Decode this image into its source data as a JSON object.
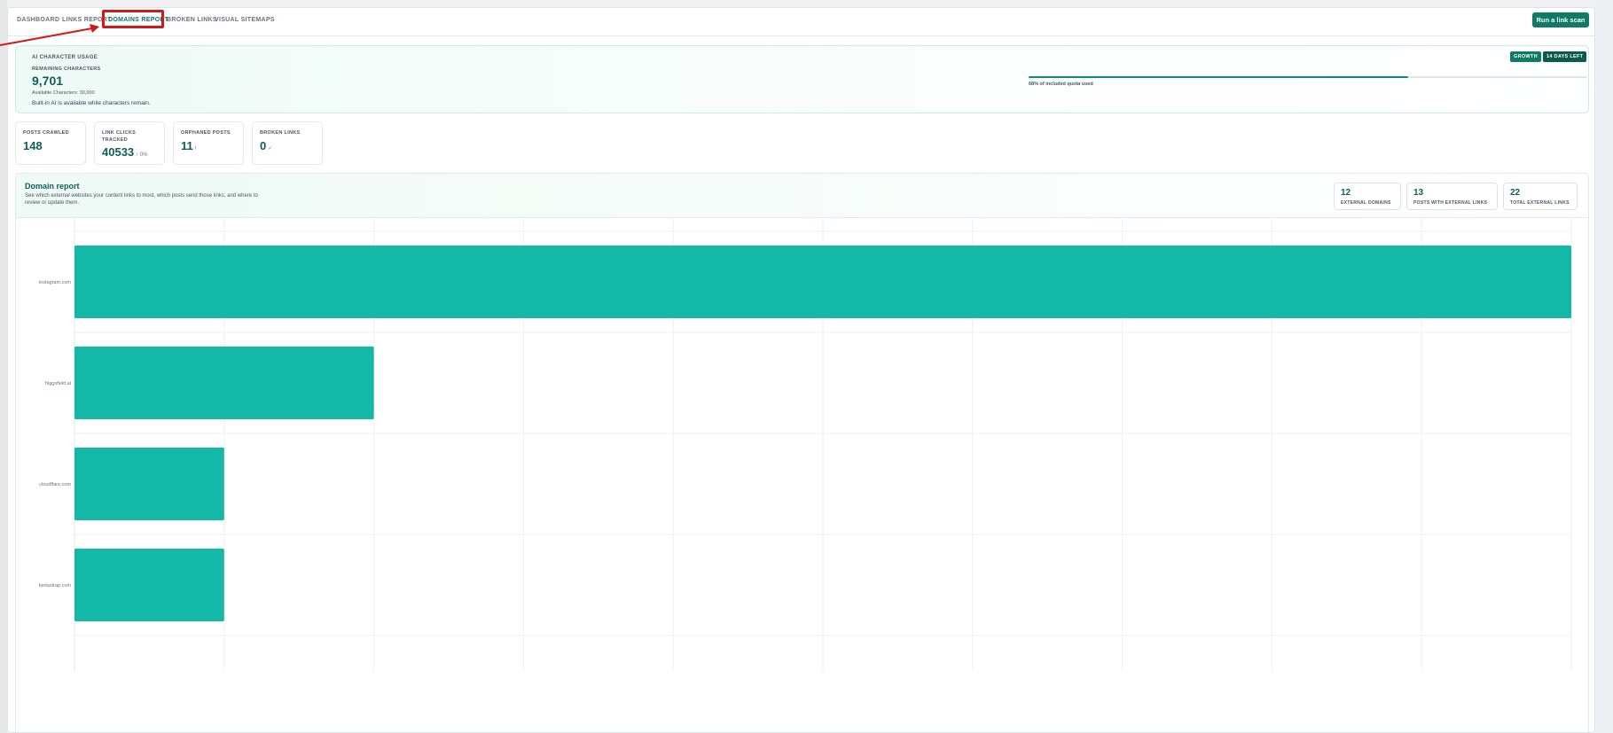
{
  "nav": {
    "items": [
      {
        "label": "DASHBOARD"
      },
      {
        "label": "LINKS REPORT"
      },
      {
        "label": "DOMAINS REPORT"
      },
      {
        "label": "BROKEN LINKS"
      },
      {
        "label": "VISUAL SITEMAPS"
      }
    ],
    "active_index": 2,
    "run_scan_label": "Run a link scan"
  },
  "ai_usage": {
    "section_label": "AI CHARACTER USAGE",
    "remaining_label": "REMAINING CHARACTERS",
    "remaining_value": "9,701",
    "available_text": "Available Characters: 30,000",
    "note": "Built-in AI is available while characters remain.",
    "plan_badge": "GROWTH",
    "days_badge": "14 DAYS LEFT",
    "quota_fraction": 0.68,
    "quota_text": "68% of included quota used"
  },
  "stats": [
    {
      "label": "POSTS CRAWLED",
      "value": "148",
      "extra": ""
    },
    {
      "label": "LINK CLICKS TRACKED",
      "value": "40533",
      "extra": "↑ 0%"
    },
    {
      "label": "ORPHANED POSTS",
      "value": "11",
      "extra": "!"
    },
    {
      "label": "BROKEN LINKS",
      "value": "0",
      "extra": "✓"
    }
  ],
  "domain_report": {
    "title": "Domain report",
    "description": "See which external websites your content links to most, which posts send those links, and where to review or update them.",
    "metrics": [
      {
        "value": "12",
        "label": "EXTERNAL DOMAINS"
      },
      {
        "value": "13",
        "label": "POSTS WITH EXTERNAL LINKS"
      },
      {
        "value": "22",
        "label": "TOTAL EXTERNAL LINKS"
      }
    ]
  },
  "chart_data": {
    "type": "bar",
    "orientation": "horizontal",
    "categories": [
      "instagram.com",
      "higgsfield.ai",
      "cloudflare.com",
      "fantastrap.com"
    ],
    "values": [
      10,
      2,
      1,
      1
    ],
    "xlim": [
      0,
      10
    ],
    "grid": true,
    "bar_color": "#14b8a6"
  },
  "colors": {
    "accent": "#0f7a66",
    "accent_text": "#115e59",
    "highlight": "#d31818"
  }
}
